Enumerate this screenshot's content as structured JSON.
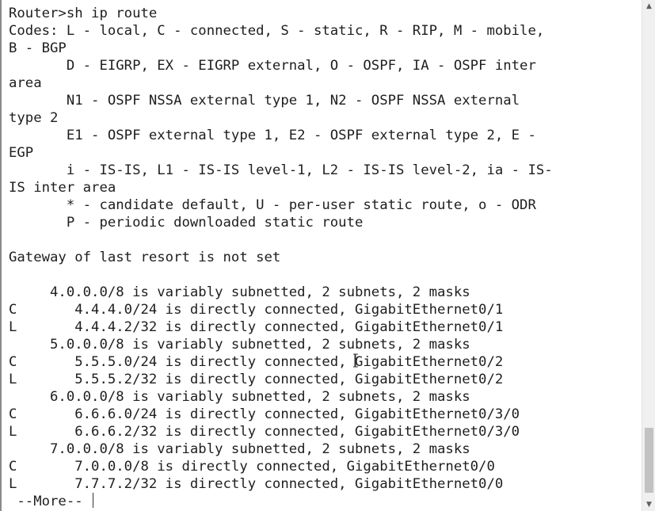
{
  "terminal": {
    "lines": [
      "Router>sh ip route",
      "Codes: L - local, C - connected, S - static, R - RIP, M - mobile,",
      "B - BGP",
      "       D - EIGRP, EX - EIGRP external, O - OSPF, IA - OSPF inter",
      "area",
      "       N1 - OSPF NSSA external type 1, N2 - OSPF NSSA external",
      "type 2",
      "       E1 - OSPF external type 1, E2 - OSPF external type 2, E -",
      "EGP",
      "       i - IS-IS, L1 - IS-IS level-1, L2 - IS-IS level-2, ia - IS-",
      "IS inter area",
      "       * - candidate default, U - per-user static route, o - ODR",
      "       P - periodic downloaded static route",
      "",
      "Gateway of last resort is not set",
      "",
      "     4.0.0.0/8 is variably subnetted, 2 subnets, 2 masks",
      "C       4.4.4.0/24 is directly connected, GigabitEthernet0/1",
      "L       4.4.4.2/32 is directly connected, GigabitEthernet0/1",
      "     5.0.0.0/8 is variably subnetted, 2 subnets, 2 masks",
      "C       5.5.5.0/24 is directly connected, GigabitEthernet0/2",
      "L       5.5.5.2/32 is directly connected, GigabitEthernet0/2",
      "     6.0.0.0/8 is variably subnetted, 2 subnets, 2 masks",
      "C       6.6.6.0/24 is directly connected, GigabitEthernet0/3/0",
      "L       6.6.6.2/32 is directly connected, GigabitEthernet0/3/0",
      "     7.0.0.0/8 is variably subnetted, 2 subnets, 2 masks",
      "C       7.0.0.0/8 is directly connected, GigabitEthernet0/0",
      "L       7.7.7.2/32 is directly connected, GigabitEthernet0/0"
    ],
    "more_prompt": " --More-- "
  },
  "scrollbar": {
    "position_fraction": 0.9
  },
  "icons": {
    "scroll_up": "chevron-up-icon",
    "scroll_down": "chevron-down-icon",
    "mouse": "text-cursor-icon"
  }
}
